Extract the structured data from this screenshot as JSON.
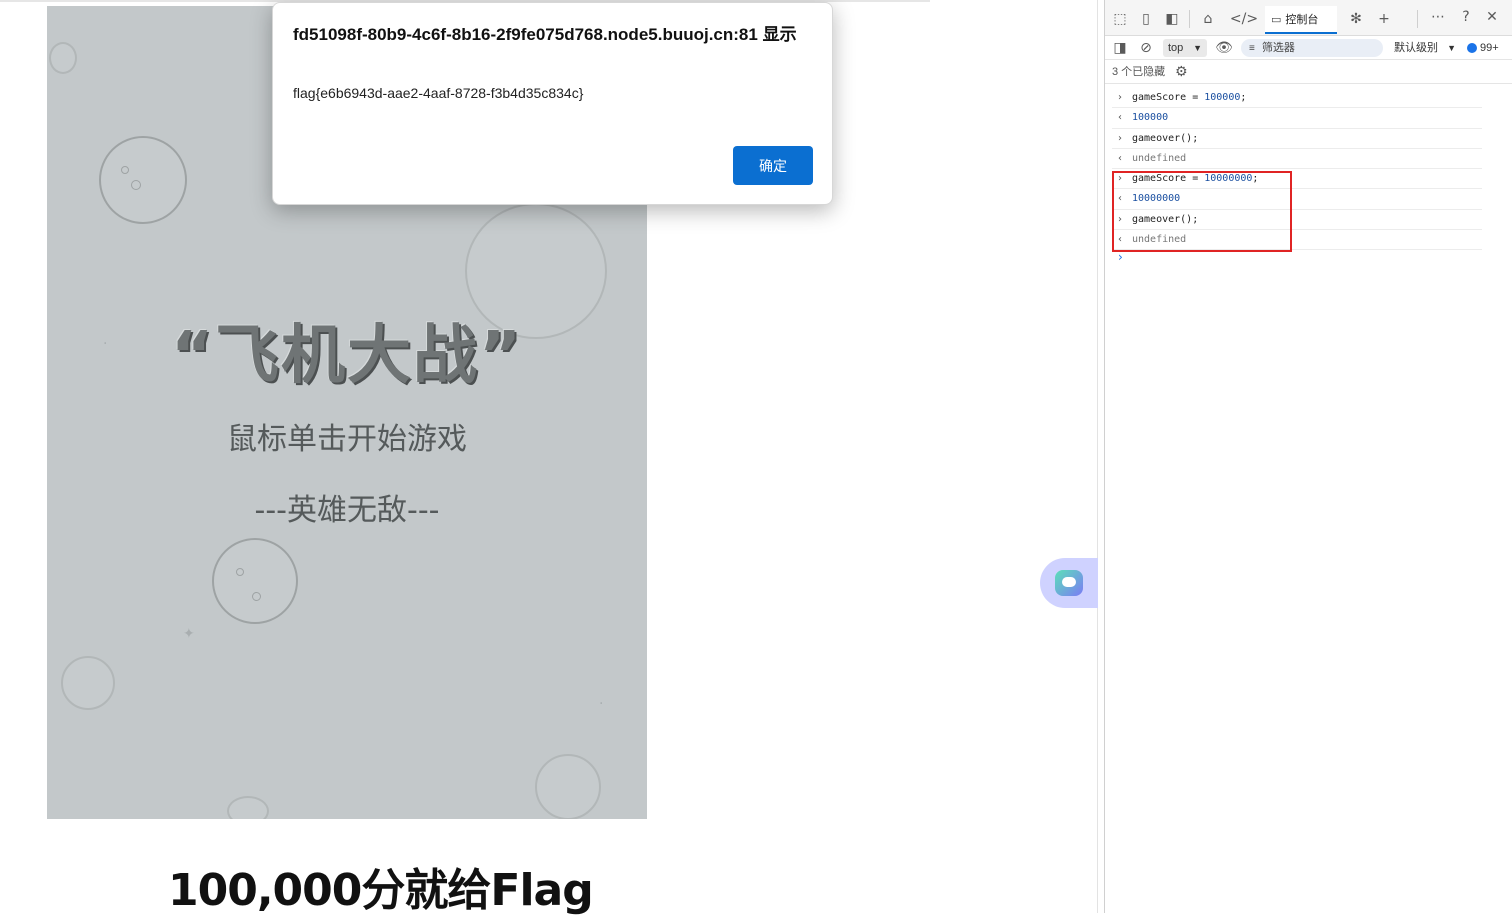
{
  "game": {
    "title": "“飞机大战”",
    "subtitle": "鼠标单击开始游戏",
    "motto": "---英雄无敌---"
  },
  "page": {
    "heading": "100,000分就给Flag"
  },
  "alert": {
    "title": "fd51098f-80b9-4c6f-8b16-2f9fe075d768.node5.buuoj.cn:81 显示",
    "message": "flag{e6b6943d-aae2-4aaf-8728-f3b4d35c834c}",
    "ok_label": "确定"
  },
  "devtools": {
    "tabs": {
      "console_label": "控制台"
    },
    "toolbar": {
      "context": "top",
      "filter_placeholder": "筛选器",
      "level": "默认级别",
      "message_count": "99+"
    },
    "hidden_notice": "3 个已隐藏",
    "console_lines": [
      {
        "kind": "input",
        "text": "gameScore = ",
        "value": "100000",
        "suffix": ";"
      },
      {
        "kind": "result",
        "text": "100000"
      },
      {
        "kind": "input",
        "text": "gameover();",
        "value": "",
        "suffix": ""
      },
      {
        "kind": "undefined",
        "text": "undefined"
      },
      {
        "kind": "input",
        "text": "gameScore = ",
        "value": "10000000",
        "suffix": ";"
      },
      {
        "kind": "result",
        "text": "10000000"
      },
      {
        "kind": "input",
        "text": "gameover();",
        "value": "",
        "suffix": ""
      },
      {
        "kind": "undefined",
        "text": "undefined"
      }
    ]
  },
  "colors": {
    "accent": "#0b6fd1",
    "highlight": "#e02424",
    "game_bg": "#c3c8ca"
  }
}
